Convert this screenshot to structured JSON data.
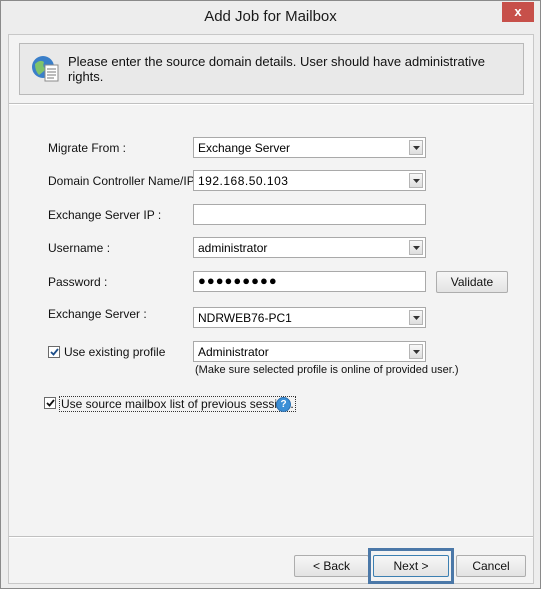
{
  "window": {
    "title": "Add Job for Mailbox",
    "close_glyph": "x"
  },
  "header": {
    "icon": "globe-document-icon",
    "text": "Please enter the source domain details. User should have administrative rights."
  },
  "form": {
    "migrate_from": {
      "label": "Migrate From :",
      "value": "Exchange Server"
    },
    "domain_controller": {
      "label": "Domain Controller Name/IP :",
      "value": "192.168.50.103"
    },
    "exchange_server_ip": {
      "label": "Exchange Server IP :",
      "value": ""
    },
    "username": {
      "label": "Username :",
      "value": "administrator"
    },
    "password": {
      "label": "Password :",
      "value": "●●●●●●●●●"
    },
    "validate_label": "Validate",
    "exchange_server": {
      "label": "Exchange Server :",
      "value": "NDRWEB76-PC1"
    },
    "use_existing_profile": {
      "label": "Use existing profile",
      "checked": true,
      "value": "Administrator"
    },
    "profile_note": "(Make sure selected profile is online of provided user.)",
    "use_source_list": {
      "label": "Use source mailbox list of previous session.",
      "checked": true
    }
  },
  "footer": {
    "back_label": "< Back",
    "next_label": "Next >",
    "cancel_label": "Cancel"
  },
  "colors": {
    "accent": "#4b78a8",
    "close": "#c7504a",
    "help": "#3b8fd6"
  }
}
